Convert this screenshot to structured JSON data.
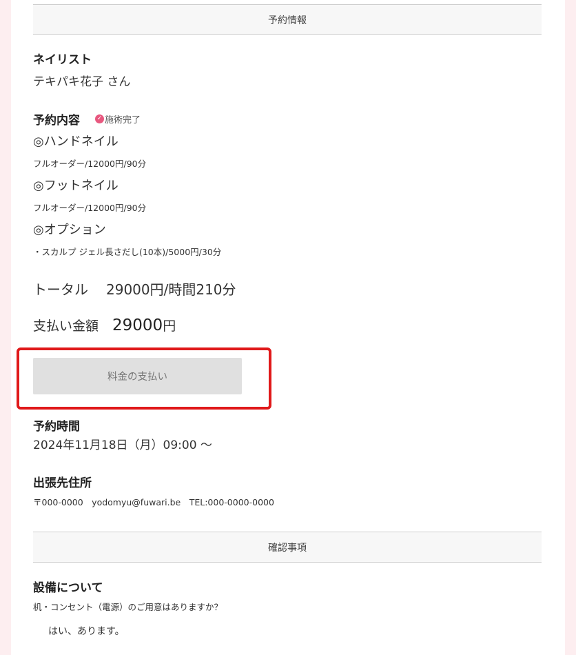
{
  "sections": {
    "reservation_info": "予約情報",
    "confirmation": "確認事項"
  },
  "nailist": {
    "label": "ネイリスト",
    "name": "テキパキ花子 さん"
  },
  "reservation_content": {
    "label": "予約内容",
    "badge": "施術完了",
    "items": [
      {
        "category": "◎ハンドネイル",
        "detail": "フルオーダー/12000円/90分"
      },
      {
        "category": "◎フットネイル",
        "detail": "フルオーダー/12000円/90分"
      },
      {
        "category": "◎オプション",
        "detail": "・スカルプ ジェル長さだし(10本)/5000円/30分"
      }
    ]
  },
  "total": {
    "label": "トータル",
    "value": "29000円/時間210分"
  },
  "payment": {
    "label": "支払い金額",
    "amount": "29000",
    "unit": "円",
    "button": "料金の支払い"
  },
  "reservation_time": {
    "label": "予約時間",
    "value": "2024年11月18日（月）09:00 ～"
  },
  "destination": {
    "label": "出張先住所",
    "value": "〒000-0000　yodomyu@fuwari.be　TEL:000-0000-0000"
  },
  "equipment": {
    "label": "設備について",
    "question": "机・コンセント（電源）のご用意はありますか？",
    "answer": "はい、あります。"
  },
  "colors": {
    "badge": "#e8587f",
    "highlight": "#e0191a",
    "page_bg": "#fdeef0"
  }
}
